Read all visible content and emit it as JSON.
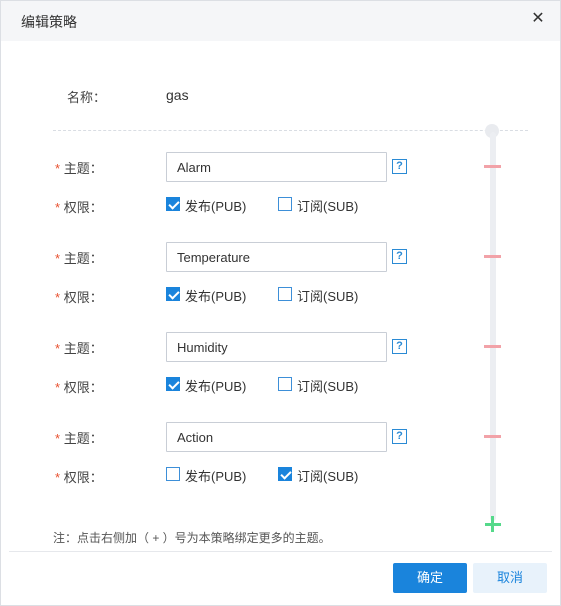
{
  "dialog": {
    "title": "编辑策略",
    "close_icon": "close-icon",
    "name_label": "名称：",
    "name_value": "gas",
    "note": "注：点击右侧加（ + ）号为本策略绑定更多的主题。",
    "ok_label": "确定",
    "cancel_label": "取消"
  },
  "topic_label": "主题：",
  "perm_label": "权限：",
  "required_mark": "*",
  "help_mark": "?",
  "pub_label": "发布(PUB)",
  "sub_label": "订阅(SUB)",
  "policies": [
    {
      "topic": "Alarm",
      "pub": true,
      "sub": false
    },
    {
      "topic": "Temperature",
      "pub": true,
      "sub": false
    },
    {
      "topic": "Humidity",
      "pub": true,
      "sub": false
    },
    {
      "topic": "Action",
      "pub": false,
      "sub": true
    }
  ],
  "colors": {
    "primary": "#1a84dc",
    "required": "#e8502f",
    "remove": "#f2a2a8",
    "add": "#55d98a"
  }
}
